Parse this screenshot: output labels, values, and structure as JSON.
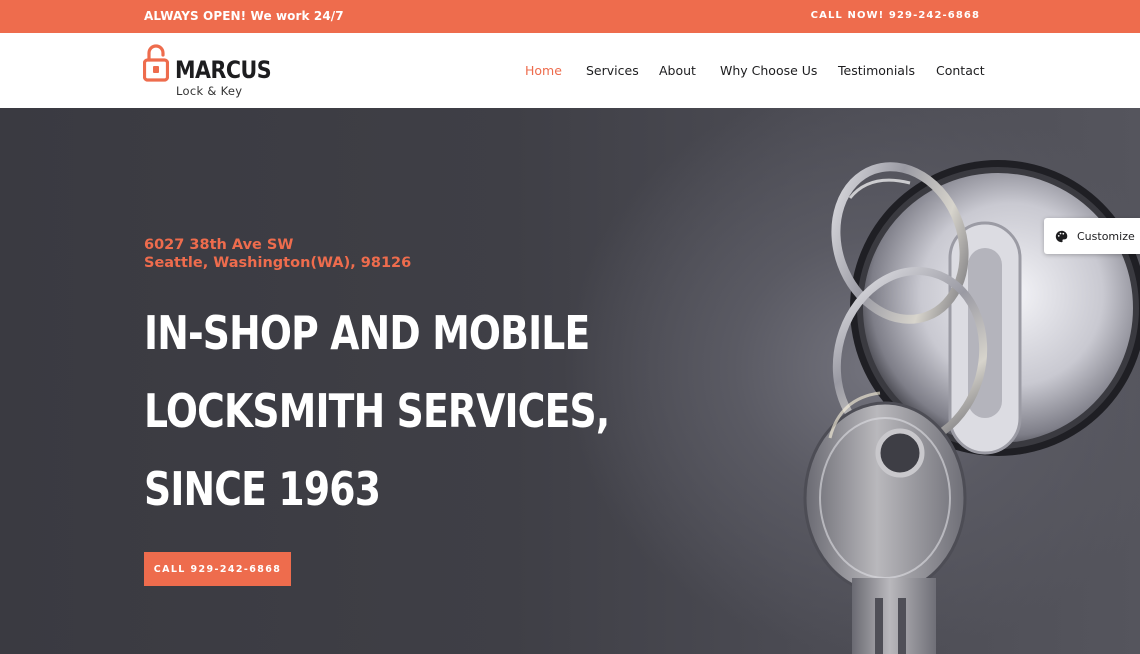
{
  "topbar": {
    "left_text": "ALWAYS OPEN! We work 24/7",
    "right_text": "CALL NOW! 929-242-6868",
    "color": "#ee6c4d"
  },
  "header": {
    "logo": {
      "brand": "MARCUS",
      "tagline": "Lock & Key",
      "icon": "padlock-icon"
    },
    "nav": [
      {
        "label": "Home",
        "active": true
      },
      {
        "label": "Services",
        "active": false
      },
      {
        "label": "About",
        "active": false
      },
      {
        "label": "Why Choose Us",
        "active": false
      },
      {
        "label": "Testimonials",
        "active": false
      },
      {
        "label": "Contact",
        "active": false
      }
    ]
  },
  "hero": {
    "address_line1": "6027 38th Ave SW",
    "address_line2": "Seattle, Washington(WA), 98126",
    "headline_line1": "IN-SHOP AND MOBILE",
    "headline_line2": "LOCKSMITH SERVICES,",
    "headline_line3": "SINCE 1963",
    "cta_label": "CALL 929-242-6868",
    "accent_color": "#ee6c4d"
  },
  "customize": {
    "label": "Customize",
    "icon": "palette-icon"
  }
}
